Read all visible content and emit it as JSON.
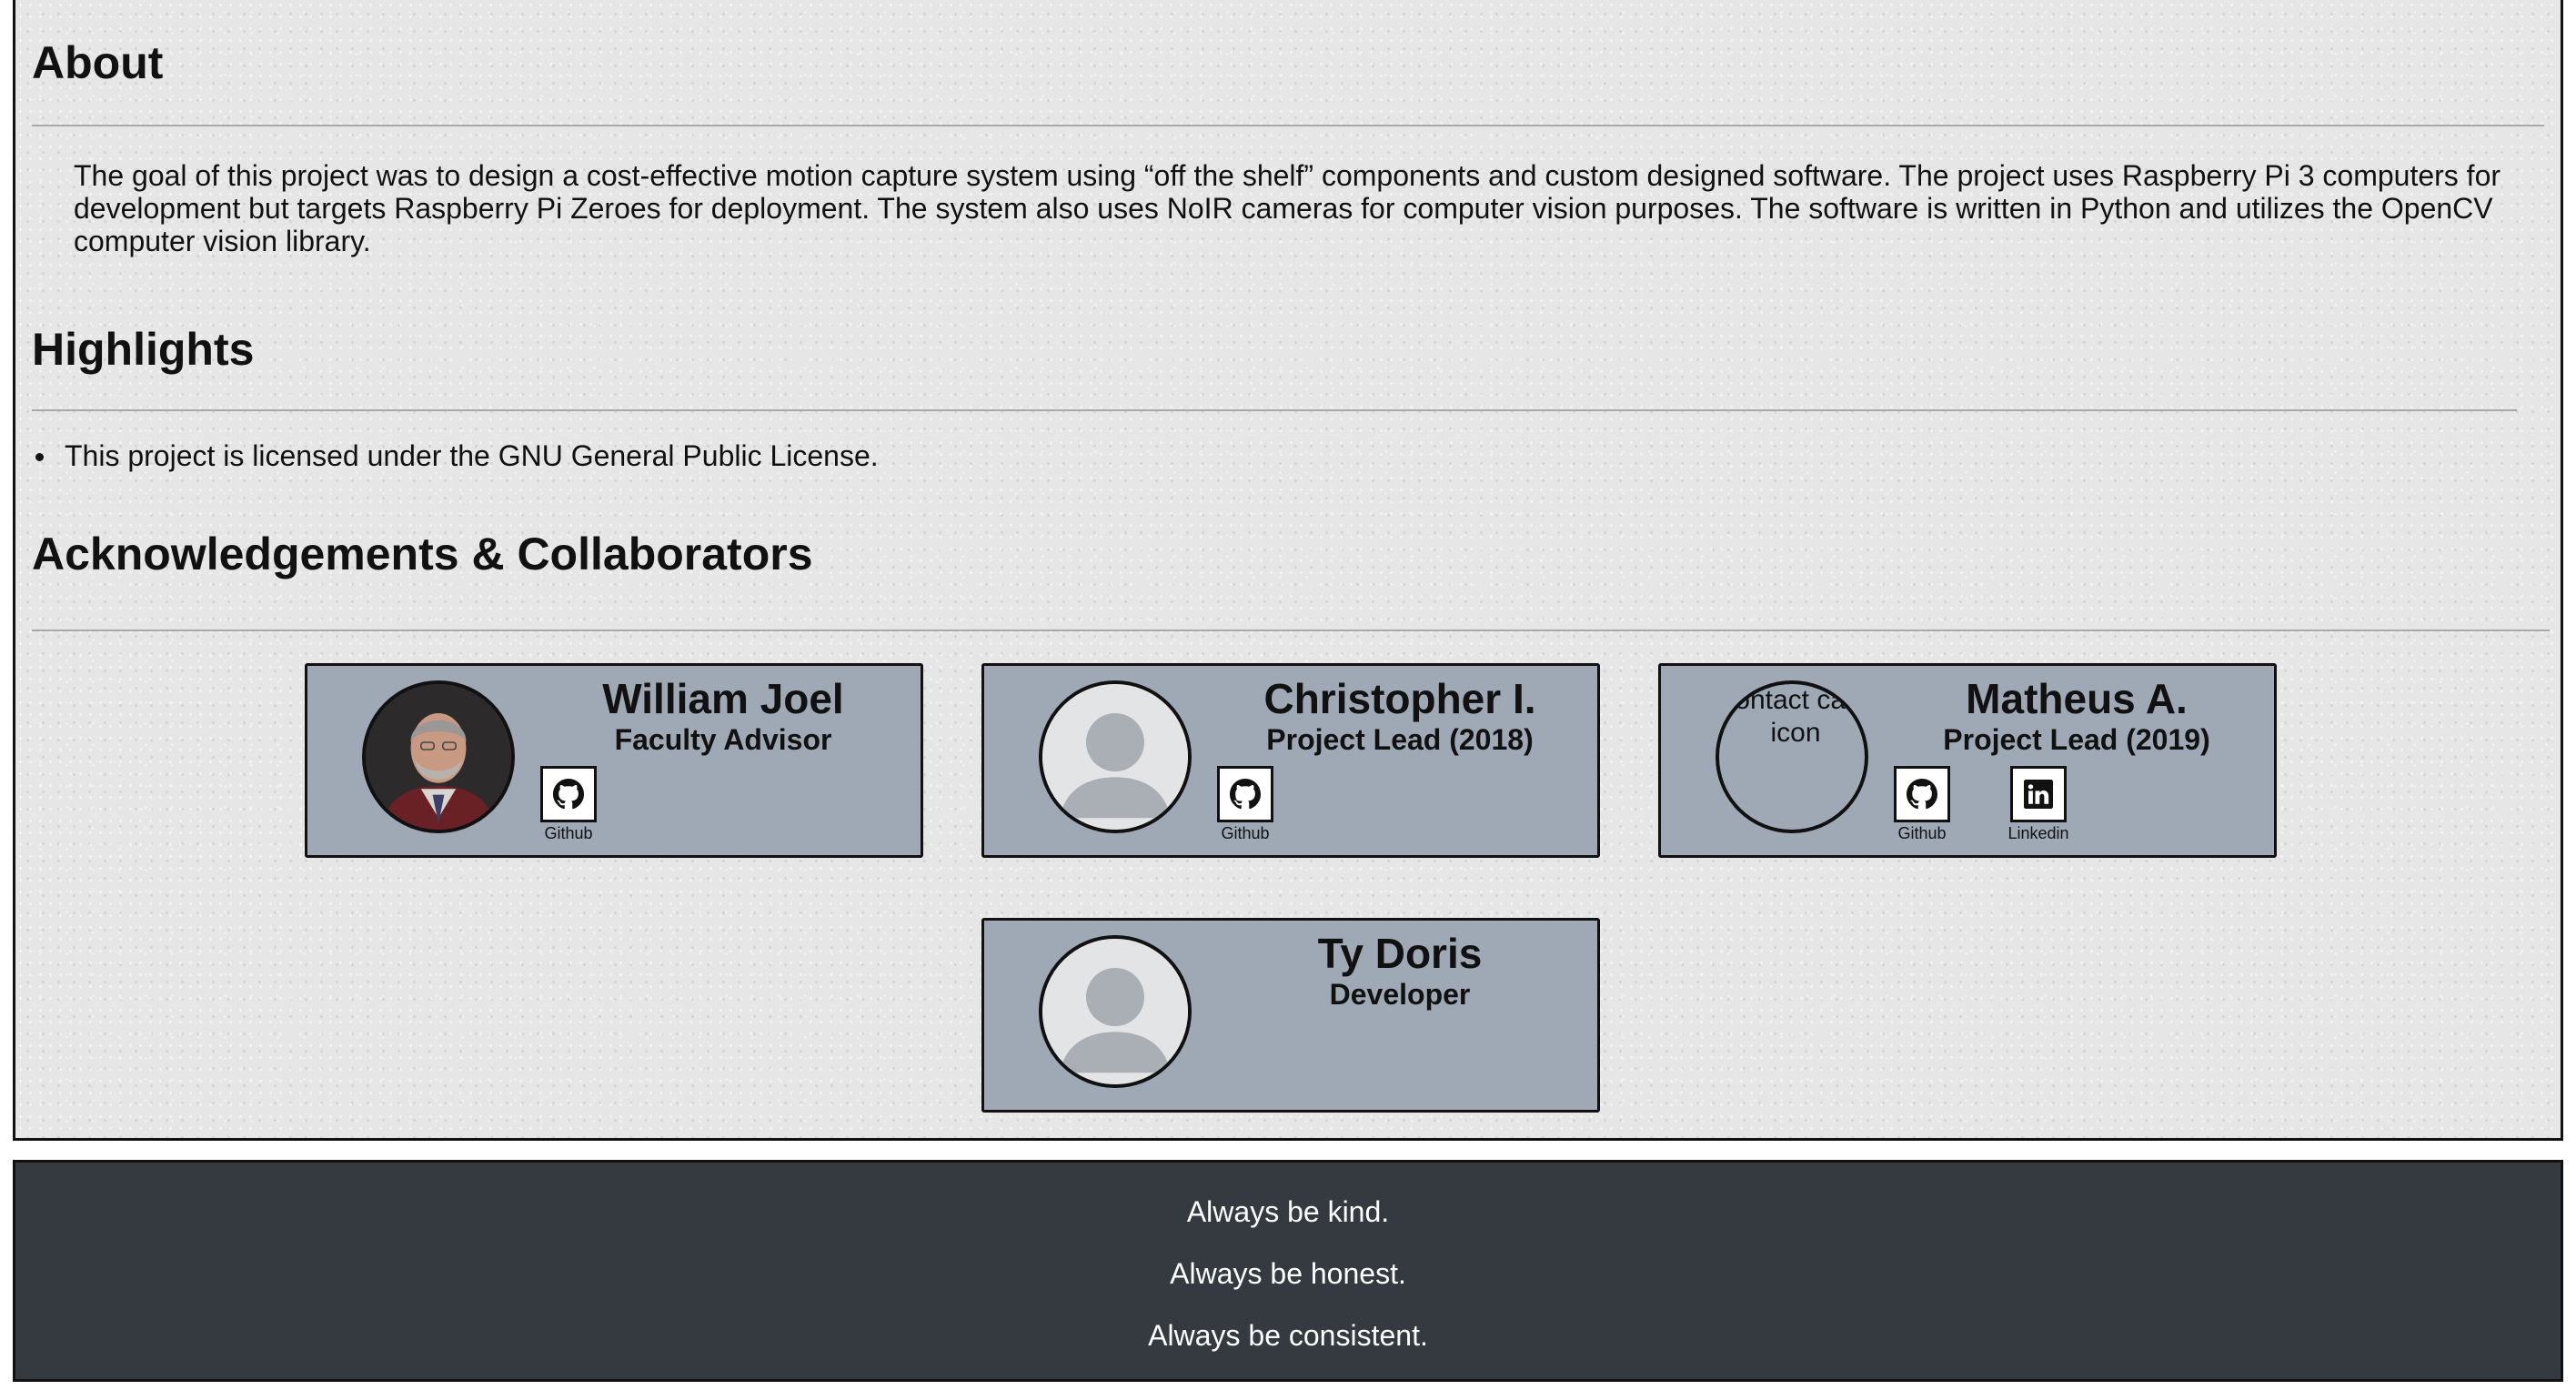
{
  "about": {
    "title": "About",
    "text": "The goal of this project was to design a cost-effective motion capture system using “off the shelf” components and custom designed software. The project uses Raspberry Pi 3 computers for development but targets Raspberry Pi Zeroes for deployment. The system also uses NoIR cameras for computer vision purposes. The software is written in Python and utilizes the OpenCV computer vision library."
  },
  "highlights": {
    "title": "Highlights",
    "items": [
      "This project is licensed under the GNU General Public License."
    ]
  },
  "acknowledgements": {
    "title": "Acknowledgements & Collaborators",
    "cards": [
      {
        "name": "William Joel",
        "role": "Faculty Advisor",
        "avatar": "photo",
        "links": [
          {
            "label": "Github",
            "icon": "github-icon"
          }
        ]
      },
      {
        "name": "Christopher I.",
        "role": "Project Lead (2018)",
        "avatar": "placeholder-person-icon",
        "links": [
          {
            "label": "Github",
            "icon": "github-icon"
          }
        ]
      },
      {
        "name": "Matheus A.",
        "role": "Project Lead (2019)",
        "avatar": "broken-image",
        "avatar_alt": "contact card icon",
        "links": [
          {
            "label": "Github",
            "icon": "github-icon"
          },
          {
            "label": "Linkedin",
            "icon": "linkedin-icon"
          }
        ]
      },
      {
        "name": "Ty Doris",
        "role": "Developer",
        "avatar": "placeholder-person-icon",
        "links": []
      }
    ]
  },
  "footer": {
    "lines": [
      "Always be kind.",
      "Always be honest.",
      "Always be consistent."
    ]
  },
  "colors": {
    "card_background": "#9ea9b5",
    "footer_background": "#343a40",
    "page_background": "#e6e6e6"
  }
}
